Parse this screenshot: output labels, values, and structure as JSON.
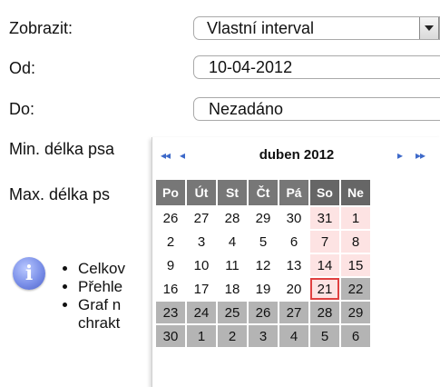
{
  "form": {
    "show_label": "Zobrazit:",
    "show_value": "Vlastní interval",
    "from_label": "Od:",
    "from_value": "10-04-2012",
    "to_label": "Do:",
    "to_value": "Nezadáno",
    "min_label": "Min. délka psa",
    "max_label": "Max. délka ps"
  },
  "info": {
    "items": [
      "Celkov",
      "Přehle",
      "Graf n"
    ],
    "item3_line2": "chrakt"
  },
  "calendar": {
    "nav_prev_year": "◂◂",
    "nav_prev_month": "◂",
    "nav_next_month": "▸",
    "nav_next_year": "▸▸",
    "title": "duben 2012",
    "weekdays": [
      "Po",
      "Út",
      "St",
      "Čt",
      "Pá",
      "So",
      "Ne"
    ],
    "weeks": [
      [
        "26",
        "27",
        "28",
        "29",
        "30",
        "31",
        "1"
      ],
      [
        "2",
        "3",
        "4",
        "5",
        "6",
        "7",
        "8"
      ],
      [
        "9",
        "10",
        "11",
        "12",
        "13",
        "14",
        "15"
      ],
      [
        "16",
        "17",
        "18",
        "19",
        "20",
        "21",
        "22"
      ],
      [
        "23",
        "24",
        "25",
        "26",
        "27",
        "28",
        "29"
      ],
      [
        "30",
        "1",
        "2",
        "3",
        "4",
        "5",
        "6"
      ]
    ],
    "today": "21",
    "colors": {
      "nav": "#3d69c9",
      "header": "#777777",
      "weekend": "#fde3e3",
      "disabled": "#b4b4b4",
      "today_border": "#e04040"
    }
  }
}
